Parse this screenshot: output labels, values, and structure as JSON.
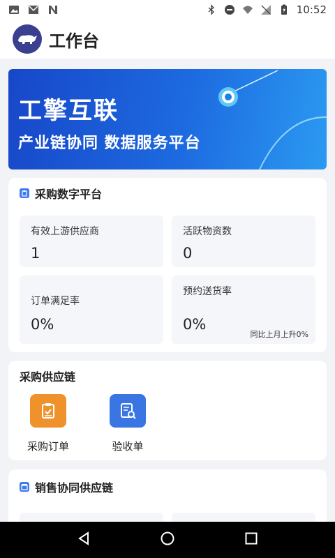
{
  "status_bar": {
    "time": "10:52"
  },
  "app_bar": {
    "title": "工作台"
  },
  "banner": {
    "title": "工擎互联",
    "subtitle": "产业链协同 数据服务平台"
  },
  "procurement_platform": {
    "title": "采购数字平台",
    "stats": [
      {
        "label": "有效上游供应商",
        "value": "1"
      },
      {
        "label": "活跃物资数",
        "value": "0"
      },
      {
        "label": "订单满足率",
        "value": "0%"
      },
      {
        "label": "预约送货率",
        "value": "0%",
        "note": "同比上月上升0%"
      }
    ]
  },
  "supply_chain": {
    "title": "采购供应链",
    "items": [
      {
        "label": "采购订单",
        "color": "#f0922b"
      },
      {
        "label": "验收单",
        "color": "#3a76e3"
      }
    ]
  },
  "sales_chain": {
    "title": "销售协同供应链"
  },
  "colors": {
    "accent": "#3d7cf0",
    "banner": "#1d6ae0",
    "orange": "#f0922b"
  }
}
